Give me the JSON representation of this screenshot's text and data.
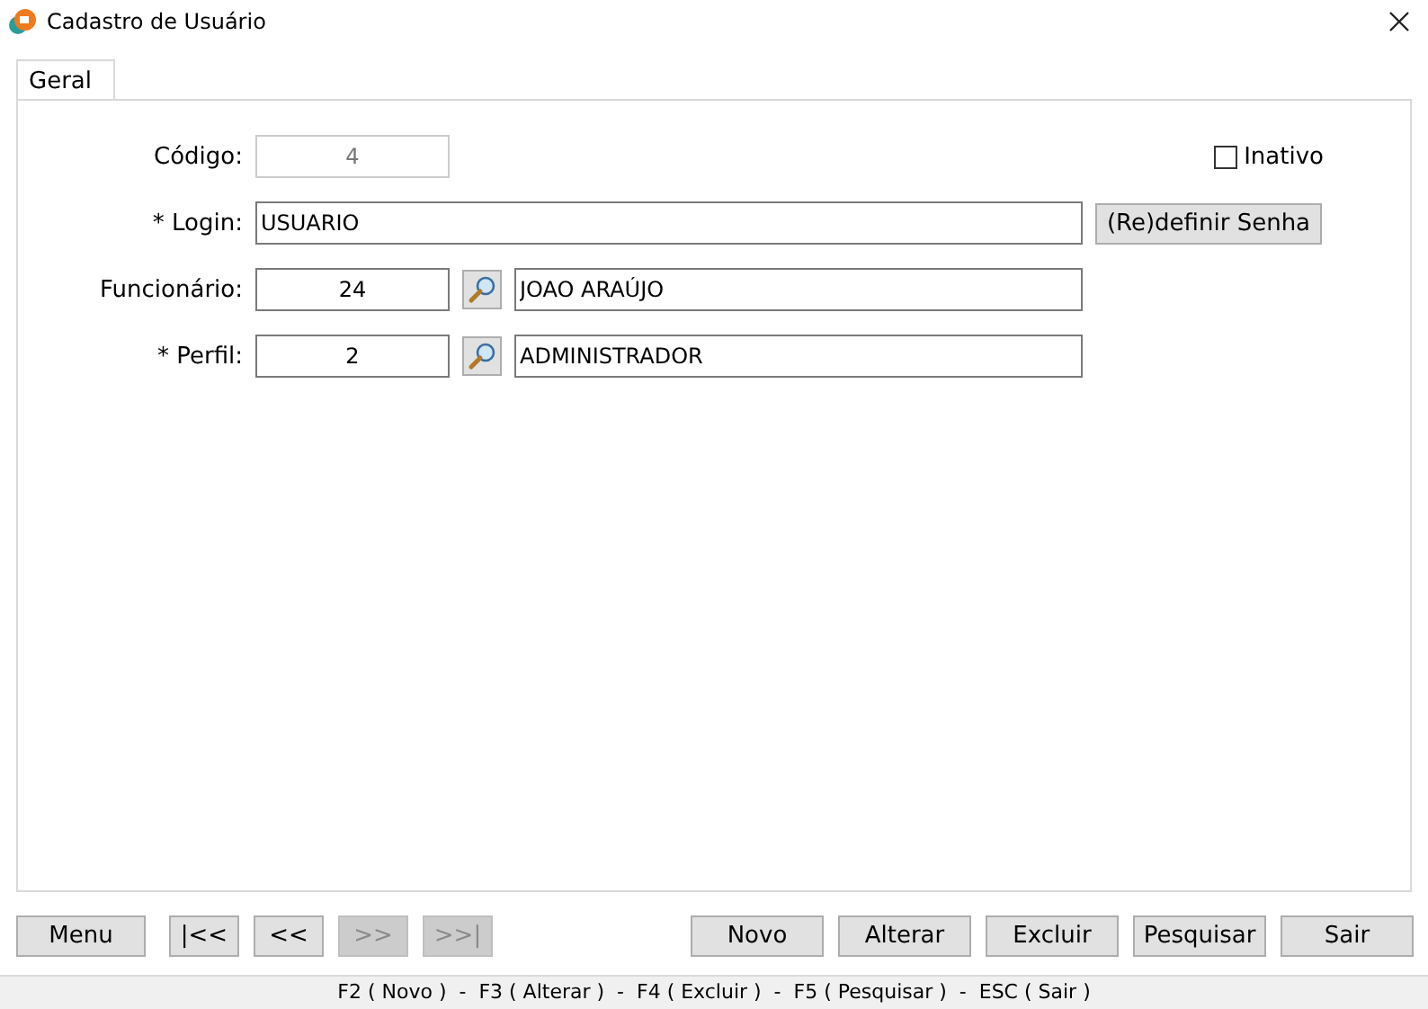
{
  "window": {
    "title": "Cadastro de Usuário"
  },
  "tabs": [
    {
      "label": "Geral",
      "selected": true
    }
  ],
  "form": {
    "codigo": {
      "label": "Código:",
      "value": "4",
      "disabled": true
    },
    "inativo": {
      "label": "Inativo",
      "checked": false
    },
    "login": {
      "label": "* Login:",
      "value": "USUARIO",
      "button": "(Re)definir Senha"
    },
    "funcionario": {
      "label": "Funcionário:",
      "code": "24",
      "name": "JOAO ARAÚJO"
    },
    "perfil": {
      "label": "* Perfil:",
      "code": "2",
      "name": "ADMINISTRADOR"
    }
  },
  "nav_buttons": [
    {
      "label": "Menu",
      "disabled": false
    },
    {
      "label": "|<<",
      "disabled": false
    },
    {
      "label": "<<",
      "disabled": false
    },
    {
      "label": ">>",
      "disabled": true
    },
    {
      "label": ">>|",
      "disabled": true
    }
  ],
  "action_buttons": [
    {
      "label": "Novo"
    },
    {
      "label": "Alterar"
    },
    {
      "label": "Excluir"
    },
    {
      "label": "Pesquisar"
    },
    {
      "label": "Sair"
    }
  ],
  "status_bar": "F2 ( Novo )  -  F3 ( Alterar )  -  F4 ( Excluir )  -  F5 ( Pesquisar )  -  ESC ( Sair )"
}
